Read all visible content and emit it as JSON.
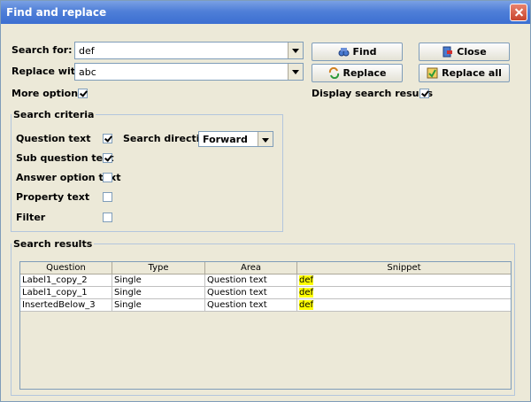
{
  "window": {
    "title": "Find and replace"
  },
  "search": {
    "search_for_label": "Search for:",
    "search_for_value": "def",
    "replace_with_label": "Replace with:",
    "replace_with_value": "abc",
    "more_options_label": "More options",
    "more_options_checked": true,
    "display_results_label": "Display search results",
    "display_results_checked": true
  },
  "buttons": {
    "find": "Find",
    "close": "Close",
    "replace": "Replace",
    "replace_all": "Replace all"
  },
  "criteria": {
    "title": "Search criteria",
    "question_text": "Question text",
    "sub_question_text": "Sub question text",
    "answer_option_text": "Answer option text",
    "property_text": "Property text",
    "filter": "Filter",
    "direction_label": "Search direction:",
    "direction_value": "Forward"
  },
  "results": {
    "title": "Search results",
    "columns": [
      "Question",
      "Type",
      "Area",
      "Snippet"
    ],
    "rows": [
      [
        "Label1_copy_2",
        "Single",
        "Question text",
        "def"
      ],
      [
        "Label1_copy_1",
        "Single",
        "Question text",
        "def"
      ],
      [
        "InsertedBelow_3",
        "Single",
        "Question text",
        "def"
      ]
    ],
    "highlight_color": "#ffff00"
  },
  "colors": {
    "title_bar": "#3c6fd1",
    "dialog_bg": "#ece9d8"
  }
}
